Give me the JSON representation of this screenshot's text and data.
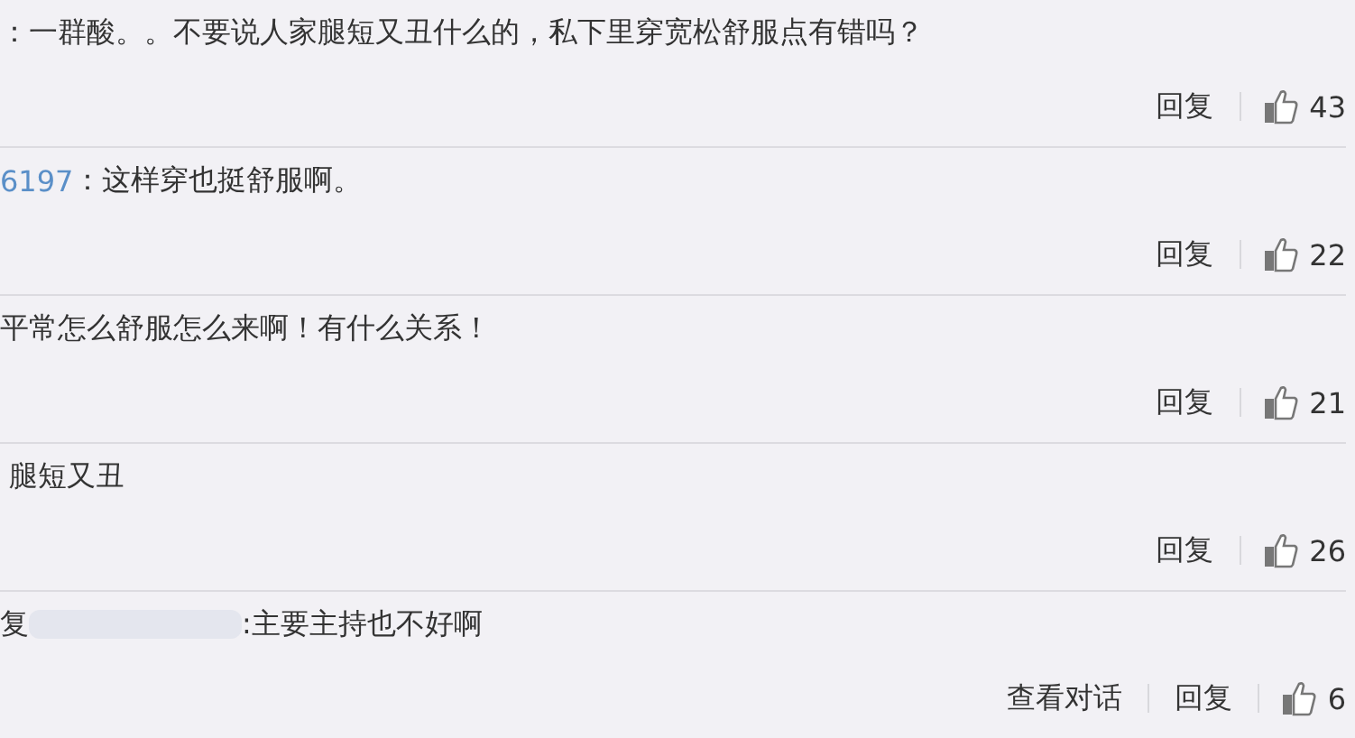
{
  "comments": [
    {
      "text": "：一群酸。。不要说人家腿短又丑什么的，私下里穿宽松舒服点有错吗？",
      "reply": "回复",
      "likes": "43"
    },
    {
      "author": "6197",
      "text": "：这样穿也挺舒服啊。",
      "reply": "回复",
      "likes": "22"
    },
    {
      "text": "平常怎么舒服怎么来啊！有什么关系！",
      "reply": "回复",
      "likes": "21"
    },
    {
      "text": " 腿短又丑",
      "reply": "回复",
      "likes": "26"
    },
    {
      "prefix": "复",
      "blurred_mention": true,
      "text": ":主要主持也不好啊",
      "view_conversation": "查看对话",
      "reply": "回复",
      "likes": "6"
    }
  ]
}
